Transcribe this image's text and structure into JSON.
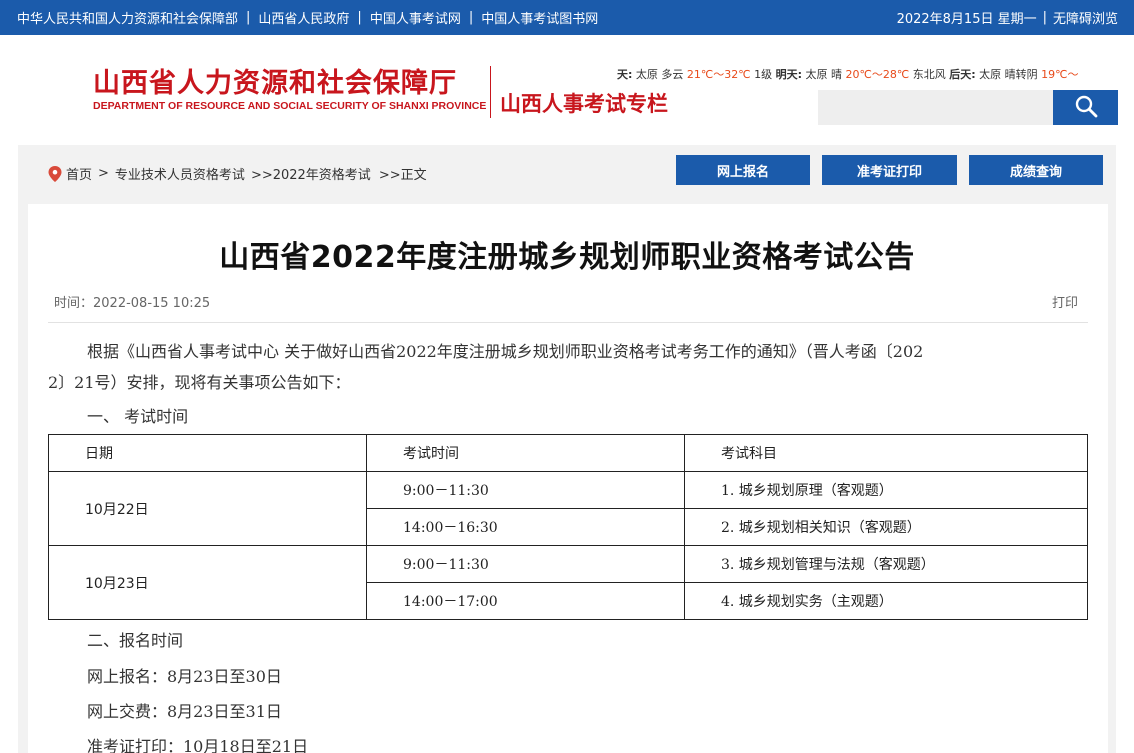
{
  "topbar": {
    "links": [
      "中华人民共和国人力资源和社会保障部",
      "山西省人民政府",
      "中国人事考试网",
      "中国人事考试图书网"
    ],
    "date": "2022年8月15日 星期一",
    "accessibility": "无障碍浏览"
  },
  "header": {
    "logo_cn": "山西省人力资源和社会保障厅",
    "logo_en": "DEPARTMENT OF RESOURCE AND SOCIAL SECURITY OF SHANXI PROVINCE",
    "subtitle": "山西人事考试专栏"
  },
  "weather": {
    "today_label": "天:",
    "today_city": "太原",
    "today_cond": "多云",
    "today_temp": "21℃～32℃",
    "today_wind": "1级",
    "tomorrow_label": "明天:",
    "tomorrow_city": "太原",
    "tomorrow_cond": "晴",
    "tomorrow_temp": "20℃～28℃",
    "tomorrow_wind": "东北风",
    "after_label": "后天:",
    "after_city": "太原",
    "after_cond": "晴转阴",
    "after_temp": "19℃～"
  },
  "search": {
    "placeholder": ""
  },
  "breadcrumb": {
    "home": "首页",
    "item1": "专业技术人员资格考试",
    "item2": ">>2022年资格考试",
    "item3": ">>正文"
  },
  "nav": {
    "register": "网上报名",
    "admit": "准考证打印",
    "score": "成绩查询"
  },
  "article": {
    "title": "山西省2022年度注册城乡规划师职业资格考试公告",
    "time": "时间：2022-08-15 10:25",
    "print": "打印",
    "intro_line1": "根据《山西省人事考试中心 关于做好山西省2022年度注册城乡规划师职业资格考试考务工作的通知》（晋人考函〔202",
    "intro_line2": "2〕21号）安排，现将有关事项公告如下：",
    "section1": "一、  考试时间",
    "section2": "二、报名时间",
    "reg_online": "网上报名：8月23日至30日",
    "pay_online": "网上交费：8月23日至31日",
    "admit_print": "准考证打印：10月18日至21日"
  },
  "table": {
    "headers": [
      "日期",
      "考试时间",
      "考试科目"
    ],
    "dates": [
      "10月22日",
      "10月23日"
    ],
    "rows": [
      {
        "time": "9:00－11:30",
        "subject": "1. 城乡规划原理（客观题）"
      },
      {
        "time": "14:00－16:30",
        "subject": "2. 城乡规划相关知识（客观题）"
      },
      {
        "time": "9:00－11:30",
        "subject": "3. 城乡规划管理与法规（客观题）"
      },
      {
        "time": "14:00－17:00",
        "subject": "4. 城乡规划实务（主观题）"
      }
    ]
  },
  "colors": {
    "brand_blue": "#1b5bab",
    "brand_red": "#c8161d",
    "temp_orange": "#e84a1a"
  }
}
